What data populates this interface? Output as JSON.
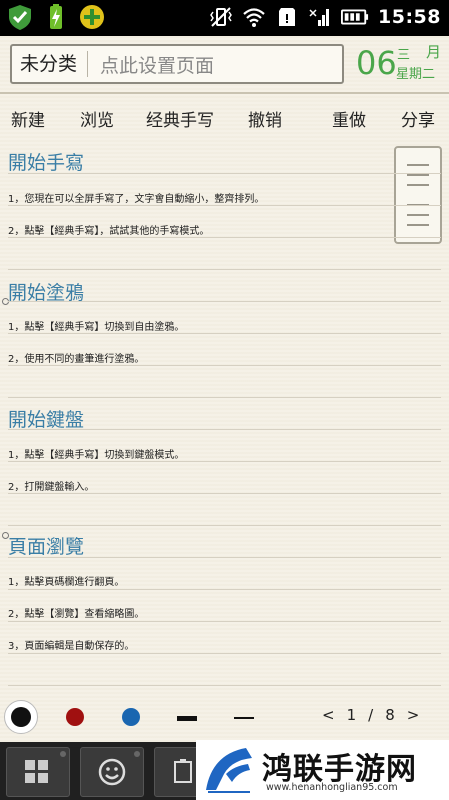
{
  "status_bar": {
    "time": "15:58",
    "left_icons": [
      "shield-check-icon",
      "battery-charging-icon",
      "plus-badge-icon"
    ],
    "right_icons": [
      "vibrate-mute-icon",
      "wifi-icon",
      "sd-card-icon",
      "signal-icon",
      "battery-icon"
    ]
  },
  "header": {
    "category_label": "未分类",
    "page_placeholder": "点此设置页面",
    "date_day": "06",
    "date_month": "三",
    "date_month_unit": "月",
    "date_weekday": "星期二"
  },
  "toolbar": {
    "new": "新建",
    "browse": "浏览",
    "classic_handwriting": "经典手写",
    "undo": "撤销",
    "redo": "重做",
    "share": "分享"
  },
  "content": {
    "sections": [
      {
        "title": "開始手寫",
        "lines": [
          "1，您現在可以全屏手寫了，文字會自動縮小，整齊排列。",
          "2，點擊【經典手寫】，試試其他的手寫模式。"
        ]
      },
      {
        "title": "開始塗鴉",
        "lines": [
          "1，點擊【經典手寫】切換到自由塗鴉。",
          "2，使用不同的畫筆進行塗鴉。"
        ]
      },
      {
        "title": "開始鍵盤",
        "lines": [
          "1，點擊【經典手寫】切換到鍵盤模式。",
          "2，打開鍵盤輸入。"
        ]
      },
      {
        "title": "頁面瀏覽",
        "lines": [
          "1，點擊頁碼欄進行翻頁。",
          "2，點擊【瀏覽】查看縮略圖。",
          "3，頁面編輯是自動保存的。"
        ]
      }
    ]
  },
  "palette": {
    "colors": [
      "#111111",
      "#a01010",
      "#1a66b0"
    ],
    "selected_color": "#111111"
  },
  "pager": {
    "prev": "<",
    "current": "1",
    "separator": "/",
    "total": "8",
    "next": ">"
  },
  "watermark": {
    "title": "鸿联手游网",
    "url": "www.henanhonglian95.com"
  }
}
